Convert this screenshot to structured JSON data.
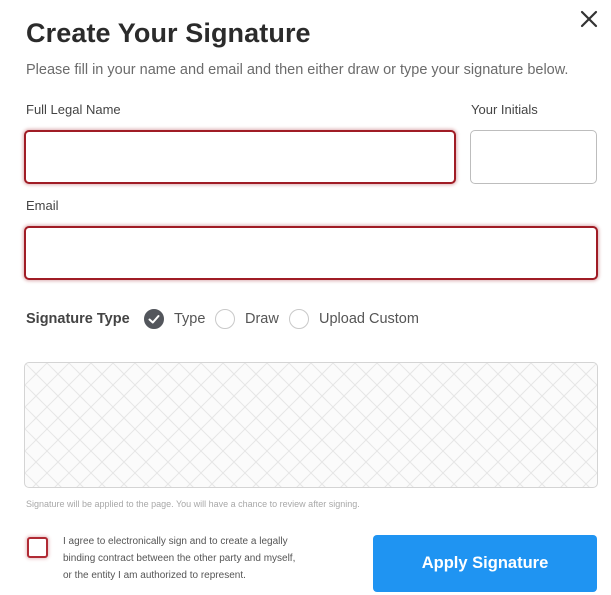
{
  "dialog": {
    "title": "Create Your Signature",
    "subtitle": "Please fill in your name and email and then either draw or type your signature below.",
    "close_icon": "close-icon"
  },
  "form": {
    "full_name_label": "Full Legal Name",
    "full_name_value": "",
    "initials_label": "Your Initials",
    "initials_value": "",
    "email_label": "Email",
    "email_value": ""
  },
  "signature_type": {
    "label": "Signature Type",
    "options": [
      {
        "label": "Type",
        "selected": true
      },
      {
        "label": "Draw",
        "selected": false
      },
      {
        "label": "Upload Custom",
        "selected": false
      }
    ]
  },
  "signature_pad": {
    "note": "Signature will be applied to the page. You will have a chance to review after signing."
  },
  "agreement": {
    "line1": "I agree to electronically sign and to create a legally",
    "line2": "binding contract between the other party and myself,",
    "line3": "or the entity I am authorized to represent.",
    "checked": false
  },
  "apply_button": {
    "label": "Apply Signature"
  },
  "colors": {
    "error_border": "#a01c25",
    "primary_button": "#1f94f2",
    "radio_checked": "#53565c"
  }
}
